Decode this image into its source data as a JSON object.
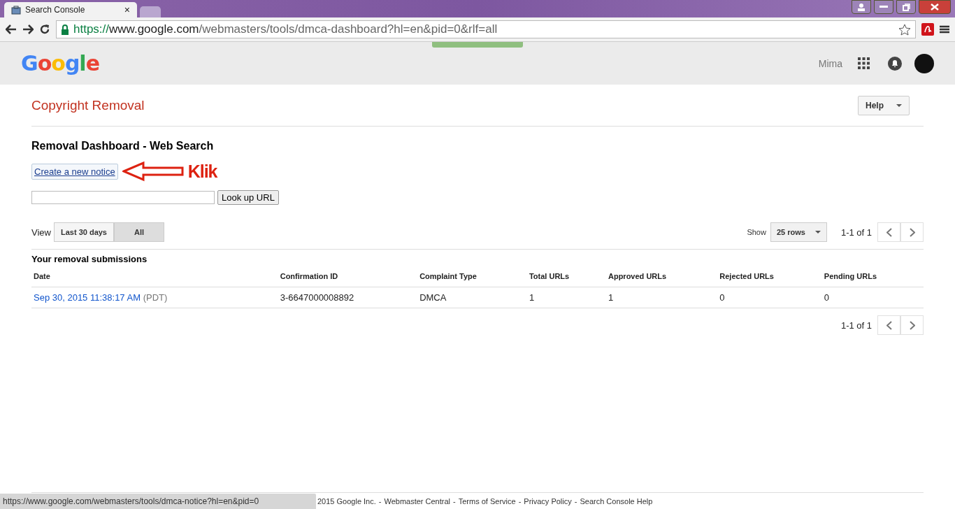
{
  "browser": {
    "tabs": [
      {
        "title": "Search Console",
        "close": "×",
        "selected": true
      },
      {
        "selected": false
      }
    ],
    "url": {
      "scheme": "https://",
      "host": "www.google.com",
      "path": "/webmasters/tools/dmca-dashboard?hl=en&pid=0&rlf=all"
    },
    "status_url": "https://www.google.com/webmasters/tools/dmca-notice?hl=en&pid=0"
  },
  "header": {
    "logo": "Google",
    "user": "Mima"
  },
  "page": {
    "title": "Copyright Removal",
    "help": "Help",
    "heading": "Removal Dashboard - Web Search",
    "create_link": "Create a new notice",
    "annotation": "Klik",
    "lookup": {
      "button": "Look up URL"
    },
    "view_label": "View",
    "view_options": [
      {
        "label": "Last 30 days",
        "selected": false
      },
      {
        "label": "All",
        "selected": true
      }
    ],
    "show_label": "Show",
    "rows_select": "25 rows",
    "pager": "1-1 of 1",
    "section": "Your removal submissions"
  },
  "table": {
    "columns": [
      "Date",
      "Confirmation ID",
      "Complaint Type",
      "Total URLs",
      "Approved URLs",
      "Rejected URLs",
      "Pending URLs"
    ],
    "rows": [
      {
        "cells": [
          {
            "text": "Sep 30, 2015 11:38:17 AM",
            "suffix": "(PDT)"
          },
          {
            "text": "3-6647000008892"
          },
          {
            "text": "DMCA"
          },
          {
            "text": "1"
          },
          {
            "text": "1"
          },
          {
            "text": "0"
          },
          {
            "text": "0"
          }
        ]
      }
    ]
  },
  "bottom_pager": "1-1 of 1",
  "footer": {
    "separator": "-",
    "links": [
      "2015 Google Inc.",
      "Webmaster Central",
      "Terms of Service",
      "Privacy Policy",
      "Search Console Help"
    ]
  }
}
